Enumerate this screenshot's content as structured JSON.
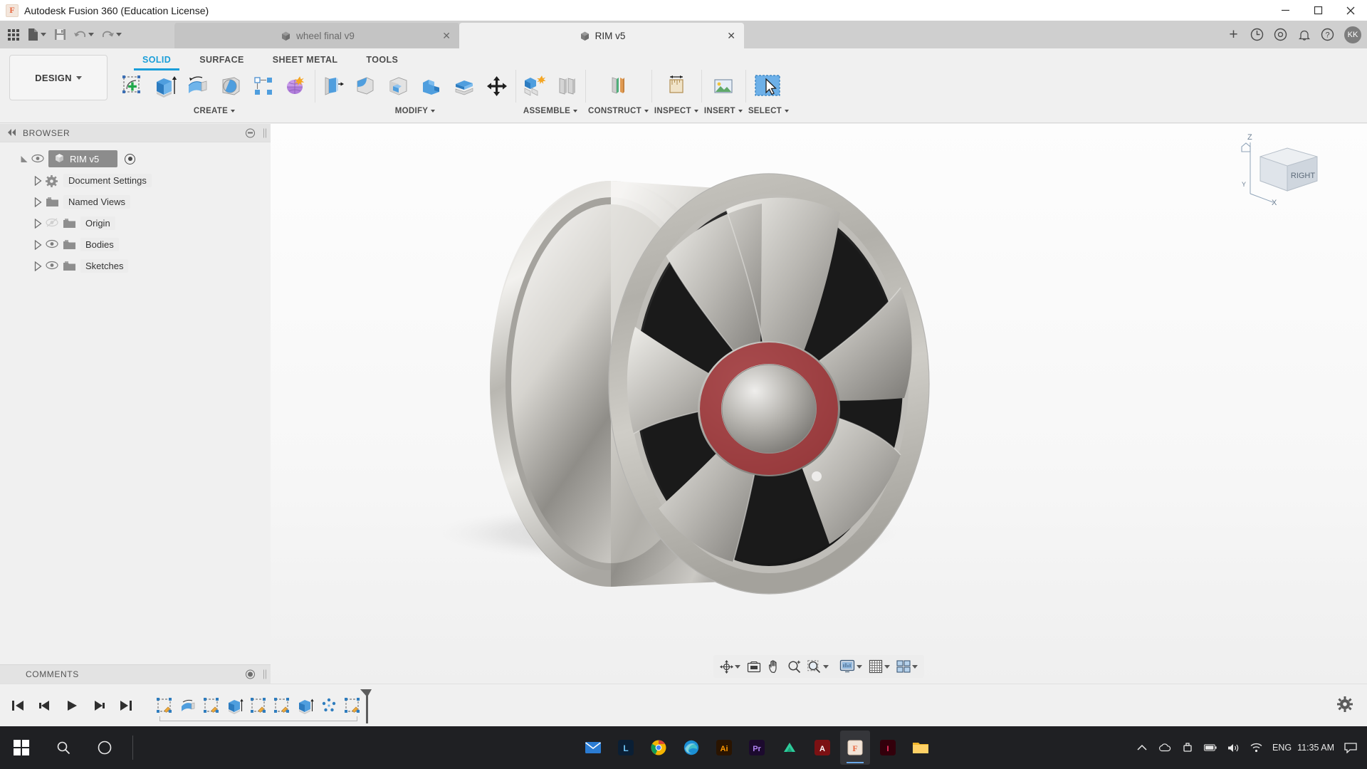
{
  "window": {
    "title": "Autodesk Fusion 360 (Education License)",
    "logo_letter": "F",
    "minimize_icon": "minimize-icon",
    "maximize_icon": "maximize-icon",
    "close_icon": "close-icon"
  },
  "quick_access": [
    {
      "name": "app-grid-icon",
      "label": "Show Data Panel"
    },
    {
      "name": "file-icon",
      "label": "File"
    },
    {
      "name": "save-icon",
      "label": "Save"
    },
    {
      "name": "undo-icon",
      "label": "Undo"
    },
    {
      "name": "redo-icon",
      "label": "Redo"
    }
  ],
  "document_tabs": [
    {
      "name": "wheel final v9",
      "active": false,
      "close": "✕"
    },
    {
      "name": "RIM v5",
      "active": true,
      "close": "✕"
    }
  ],
  "tabstrip_right": {
    "add_tab": "+",
    "icons": [
      "job-status-icon",
      "extensions-icon",
      "notifications-icon",
      "help-icon"
    ],
    "avatar_initials": "KK"
  },
  "ribbon": {
    "design_label": "DESIGN",
    "tabs": [
      {
        "label": "SOLID",
        "active": true
      },
      {
        "label": "SURFACE",
        "active": false
      },
      {
        "label": "SHEET METAL",
        "active": false
      },
      {
        "label": "TOOLS",
        "active": false
      }
    ],
    "groups": [
      {
        "label": "CREATE",
        "has_caret": true,
        "buttons": [
          {
            "name": "create-sketch-icon",
            "label": "Create Sketch"
          },
          {
            "name": "extrude-icon",
            "label": "Extrude"
          },
          {
            "name": "revolve-icon",
            "label": "Revolve"
          },
          {
            "name": "sweep-icon",
            "label": "Sweep"
          },
          {
            "name": "pattern-icon",
            "label": "Pattern"
          },
          {
            "name": "form-icon",
            "label": "Create Form"
          }
        ]
      },
      {
        "label": "MODIFY",
        "has_caret": true,
        "buttons": [
          {
            "name": "press-pull-icon",
            "label": "Press Pull"
          },
          {
            "name": "fillet-icon",
            "label": "Fillet"
          },
          {
            "name": "shell-icon",
            "label": "Shell"
          },
          {
            "name": "combine-icon",
            "label": "Combine"
          },
          {
            "name": "split-face-icon",
            "label": "Split Face"
          },
          {
            "name": "move-copy-icon",
            "label": "Move/Copy"
          }
        ]
      },
      {
        "label": "ASSEMBLE",
        "has_caret": true,
        "buttons": [
          {
            "name": "new-component-icon",
            "label": "New Component"
          },
          {
            "name": "joint-icon",
            "label": "Joint"
          }
        ]
      },
      {
        "label": "CONSTRUCT",
        "has_caret": true,
        "buttons": [
          {
            "name": "offset-plane-icon",
            "label": "Offset Plane"
          }
        ]
      },
      {
        "label": "INSPECT",
        "has_caret": true,
        "buttons": [
          {
            "name": "measure-icon",
            "label": "Measure"
          }
        ]
      },
      {
        "label": "INSERT",
        "has_caret": true,
        "buttons": [
          {
            "name": "insert-image-icon",
            "label": "Canvas"
          }
        ]
      },
      {
        "label": "SELECT",
        "has_caret": true,
        "buttons": [
          {
            "name": "select-cursor-icon",
            "label": "Select"
          }
        ]
      }
    ]
  },
  "browser": {
    "title": "BROWSER",
    "collapse_icon": "collapse-left-icon",
    "settings_icon": "panel-settings-icon",
    "tree": [
      {
        "label": "RIM v5",
        "level": 0,
        "icon": "component-icon",
        "eye": true,
        "selected": true,
        "radio": true
      },
      {
        "label": "Document Settings",
        "level": 1,
        "icon": "gear-icon",
        "eye": false
      },
      {
        "label": "Named Views",
        "level": 1,
        "icon": "folder-icon",
        "eye": false
      },
      {
        "label": "Origin",
        "level": 1,
        "icon": "folder-icon",
        "eye": true,
        "eye_off": true
      },
      {
        "label": "Bodies",
        "level": 1,
        "icon": "folder-icon",
        "eye": true
      },
      {
        "label": "Sketches",
        "level": 1,
        "icon": "folder-icon",
        "eye": true
      }
    ]
  },
  "comments": {
    "title": "COMMENTS",
    "add_icon": "add-comment-icon"
  },
  "viewcube": {
    "face_label": "RIGHT",
    "axes": {
      "z": "Z",
      "y": "Y",
      "x": "X"
    }
  },
  "nav_toolbar": [
    {
      "name": "orbit-icon",
      "label": "Orbit",
      "caret": true
    },
    {
      "name": "look-at-icon",
      "label": "Look At",
      "caret": false
    },
    {
      "name": "pan-icon",
      "label": "Pan",
      "caret": false
    },
    {
      "name": "zoom-icon",
      "label": "Zoom",
      "caret": false
    },
    {
      "name": "zoom-window-icon",
      "label": "Fit",
      "caret": true
    },
    {
      "name": "display-settings-icon",
      "label": "Display Settings",
      "caret": true
    },
    {
      "name": "grid-snaps-icon",
      "label": "Grid and Snaps",
      "caret": true
    },
    {
      "name": "viewports-icon",
      "label": "Viewports",
      "caret": true
    }
  ],
  "timeline": {
    "playback": [
      {
        "name": "jump-to-beginning-icon"
      },
      {
        "name": "step-back-icon"
      },
      {
        "name": "play-icon"
      },
      {
        "name": "step-forward-icon"
      },
      {
        "name": "jump-to-end-icon"
      }
    ],
    "features": [
      {
        "name": "sketch-feature-icon"
      },
      {
        "name": "revolve-feature-icon"
      },
      {
        "name": "sketch-feature-icon"
      },
      {
        "name": "extrude-feature-icon"
      },
      {
        "name": "sketch-feature-icon"
      },
      {
        "name": "sketch-feature-icon"
      },
      {
        "name": "extrude-feature-icon"
      },
      {
        "name": "pattern-feature-icon"
      },
      {
        "name": "sketch-feature-icon"
      }
    ],
    "settings_icon": "timeline-settings-icon"
  },
  "taskbar": {
    "start_icon": "windows-start-icon",
    "search_icon": "search-icon",
    "taskview_icon": "task-view-icon",
    "apps": [
      {
        "name": "mail-icon",
        "active": false
      },
      {
        "name": "lightroom-icon",
        "active": false
      },
      {
        "name": "chrome-icon",
        "active": false
      },
      {
        "name": "edge-icon",
        "active": false
      },
      {
        "name": "illustrator-icon",
        "active": false
      },
      {
        "name": "premiere-icon",
        "active": false
      },
      {
        "name": "photoshop-icon",
        "active": false
      },
      {
        "name": "autodesk-icon",
        "active": false
      },
      {
        "name": "fusion360-icon",
        "active": true
      },
      {
        "name": "indesign-icon",
        "active": false
      },
      {
        "name": "explorer-icon",
        "active": false
      }
    ],
    "tray": {
      "show_hidden": "chevron-up-icon",
      "icons": [
        "onedrive-icon",
        "usb-icon",
        "battery-icon",
        "volume-icon",
        "network-icon"
      ],
      "language": "ENG",
      "time": "11:35 AM",
      "action_center": "action-center-icon"
    }
  }
}
